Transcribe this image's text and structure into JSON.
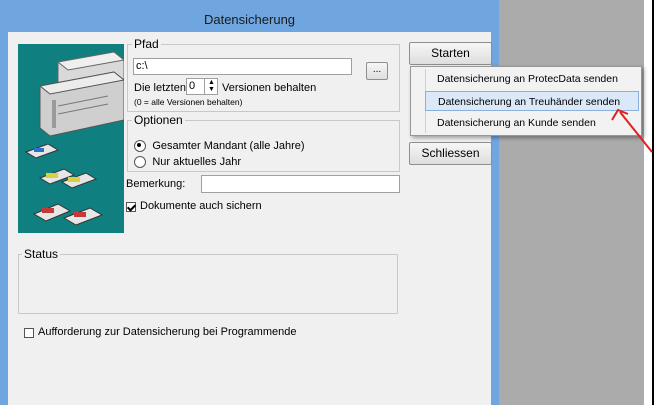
{
  "window": {
    "title": "Datensicherung"
  },
  "pfad": {
    "legend": "Pfad",
    "value": "c:\\",
    "browse_label": "...",
    "versions_prefix": "Die letzten",
    "versions_value": "0",
    "versions_suffix": "Versionen behalten",
    "versions_hint": "(0 = alle Versionen behalten)"
  },
  "optionen": {
    "legend": "Optionen",
    "radio_all": "Gesamter Mandant (alle Jahre)",
    "radio_current": "Nur aktuelles Jahr"
  },
  "bemerkung": {
    "label": "Bemerkung:",
    "value": ""
  },
  "dokumente_label": "Dokumente auch sichern",
  "status": {
    "legend": "Status"
  },
  "reminder_label": "Aufforderung zur Datensicherung bei Programmende",
  "buttons": {
    "starten": "Starten",
    "schliessen": "Schliessen"
  },
  "menu": {
    "items": [
      "Datensicherung an ProtecData senden",
      "Datensicherung an Treuhänder senden",
      "Datensicherung an Kunde senden"
    ]
  }
}
